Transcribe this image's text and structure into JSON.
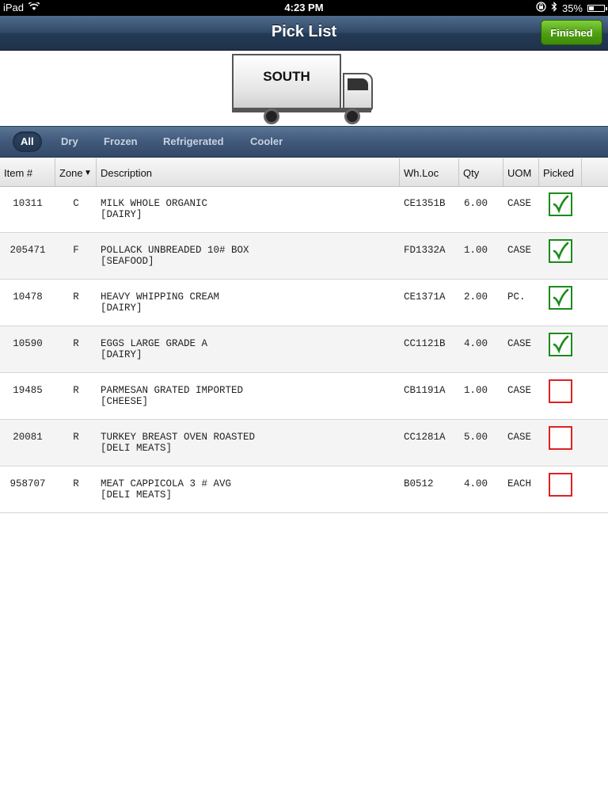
{
  "status_bar": {
    "device": "iPad",
    "time": "4:23 PM",
    "battery": "35%",
    "battery_level": 0.35
  },
  "nav": {
    "title": "Pick List",
    "finished_label": "Finished"
  },
  "truck": {
    "label": "SOUTH"
  },
  "filters": [
    {
      "label": "All",
      "active": true
    },
    {
      "label": "Dry",
      "active": false
    },
    {
      "label": "Frozen",
      "active": false
    },
    {
      "label": "Refrigerated",
      "active": false
    },
    {
      "label": "Cooler",
      "active": false
    }
  ],
  "columns": {
    "item": "Item #",
    "zone": "Zone",
    "description": "Description",
    "whloc": "Wh.Loc",
    "qty": "Qty",
    "uom": "UOM",
    "picked": "Picked"
  },
  "rows": [
    {
      "item": "10311",
      "zone": "C",
      "desc": "MILK WHOLE ORGANIC",
      "category": "[DAIRY]",
      "whloc": "CE1351B",
      "qty": "6.00",
      "uom": "CASE",
      "picked": true
    },
    {
      "item": "205471",
      "zone": "F",
      "desc": "POLLACK UNBREADED 10# BOX",
      "category": "[SEAFOOD]",
      "whloc": "FD1332A",
      "qty": "1.00",
      "uom": "CASE",
      "picked": true
    },
    {
      "item": "10478",
      "zone": "R",
      "desc": "HEAVY WHIPPING CREAM",
      "category": "[DAIRY]",
      "whloc": "CE1371A",
      "qty": "2.00",
      "uom": "PC.",
      "picked": true
    },
    {
      "item": "10590",
      "zone": "R",
      "desc": "EGGS LARGE GRADE A",
      "category": "[DAIRY]",
      "whloc": "CC1121B",
      "qty": "4.00",
      "uom": "CASE",
      "picked": true
    },
    {
      "item": "19485",
      "zone": "R",
      "desc": "PARMESAN GRATED IMPORTED",
      "category": "[CHEESE]",
      "whloc": "CB1191A",
      "qty": "1.00",
      "uom": "CASE",
      "picked": false
    },
    {
      "item": "20081",
      "zone": "R",
      "desc": "TURKEY BREAST OVEN ROASTED",
      "category": "[DELI MEATS]",
      "whloc": "CC1281A",
      "qty": "5.00",
      "uom": "CASE",
      "picked": false
    },
    {
      "item": "958707",
      "zone": "R",
      "desc": "MEAT CAPPICOLA 3 # AVG",
      "category": "[DELI MEATS]",
      "whloc": "B0512",
      "qty": "4.00",
      "uom": "EACH",
      "picked": false
    }
  ],
  "colors": {
    "picked": "#1c8a1c",
    "unpicked": "#dd2222",
    "finished_button": "#5aa81a",
    "nav": "#2f4866"
  }
}
